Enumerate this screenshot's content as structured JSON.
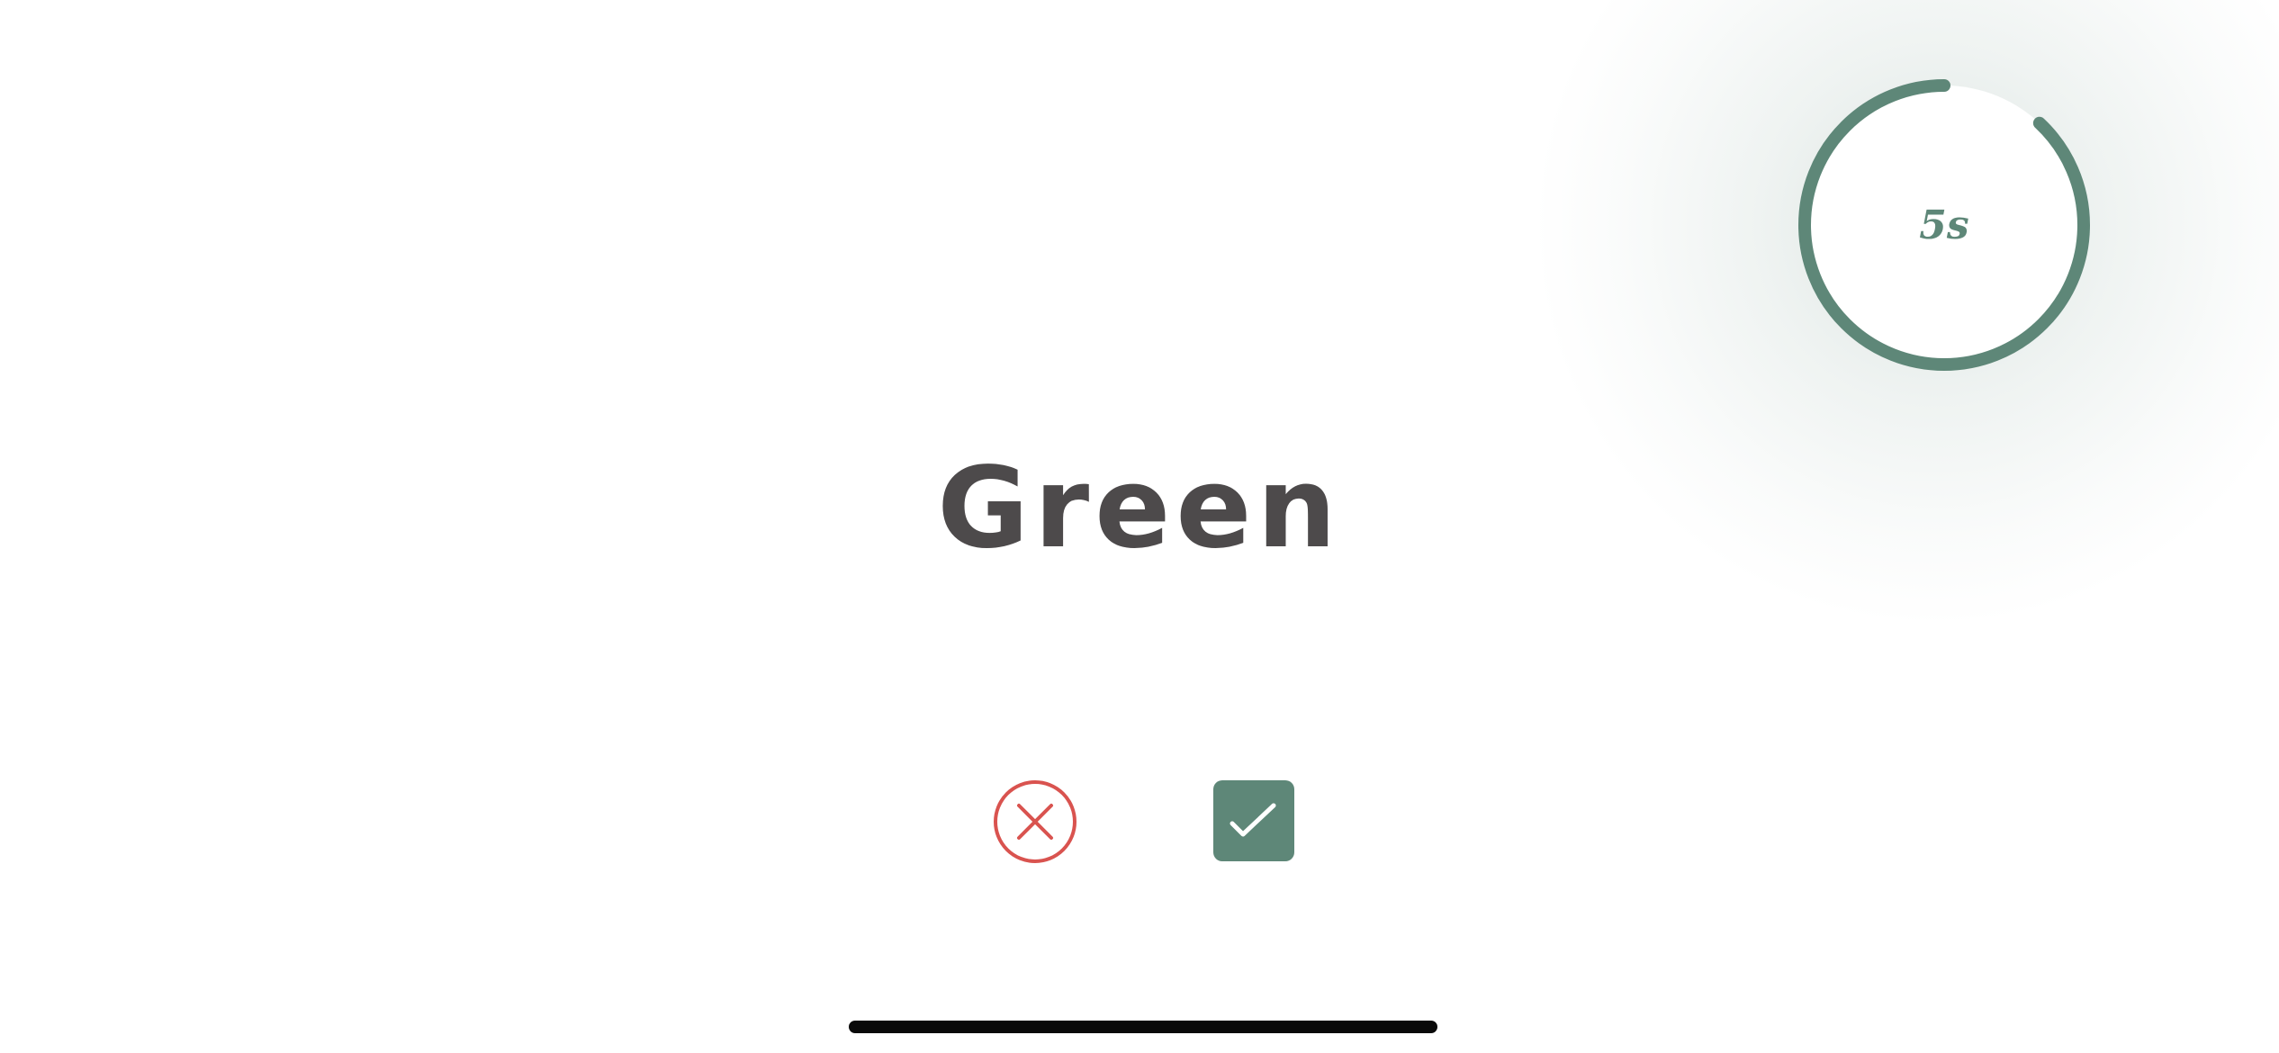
{
  "timer": {
    "label": "5s",
    "progress": 0.88,
    "color": "#5e8778"
  },
  "word": {
    "text": "Green",
    "color": "#4d4a4b"
  },
  "actions": {
    "reject": {
      "icon": "close-icon",
      "color": "#d9534f"
    },
    "accept": {
      "icon": "check-icon",
      "color": "#5e8778"
    }
  },
  "system": {
    "home_indicator": true
  }
}
